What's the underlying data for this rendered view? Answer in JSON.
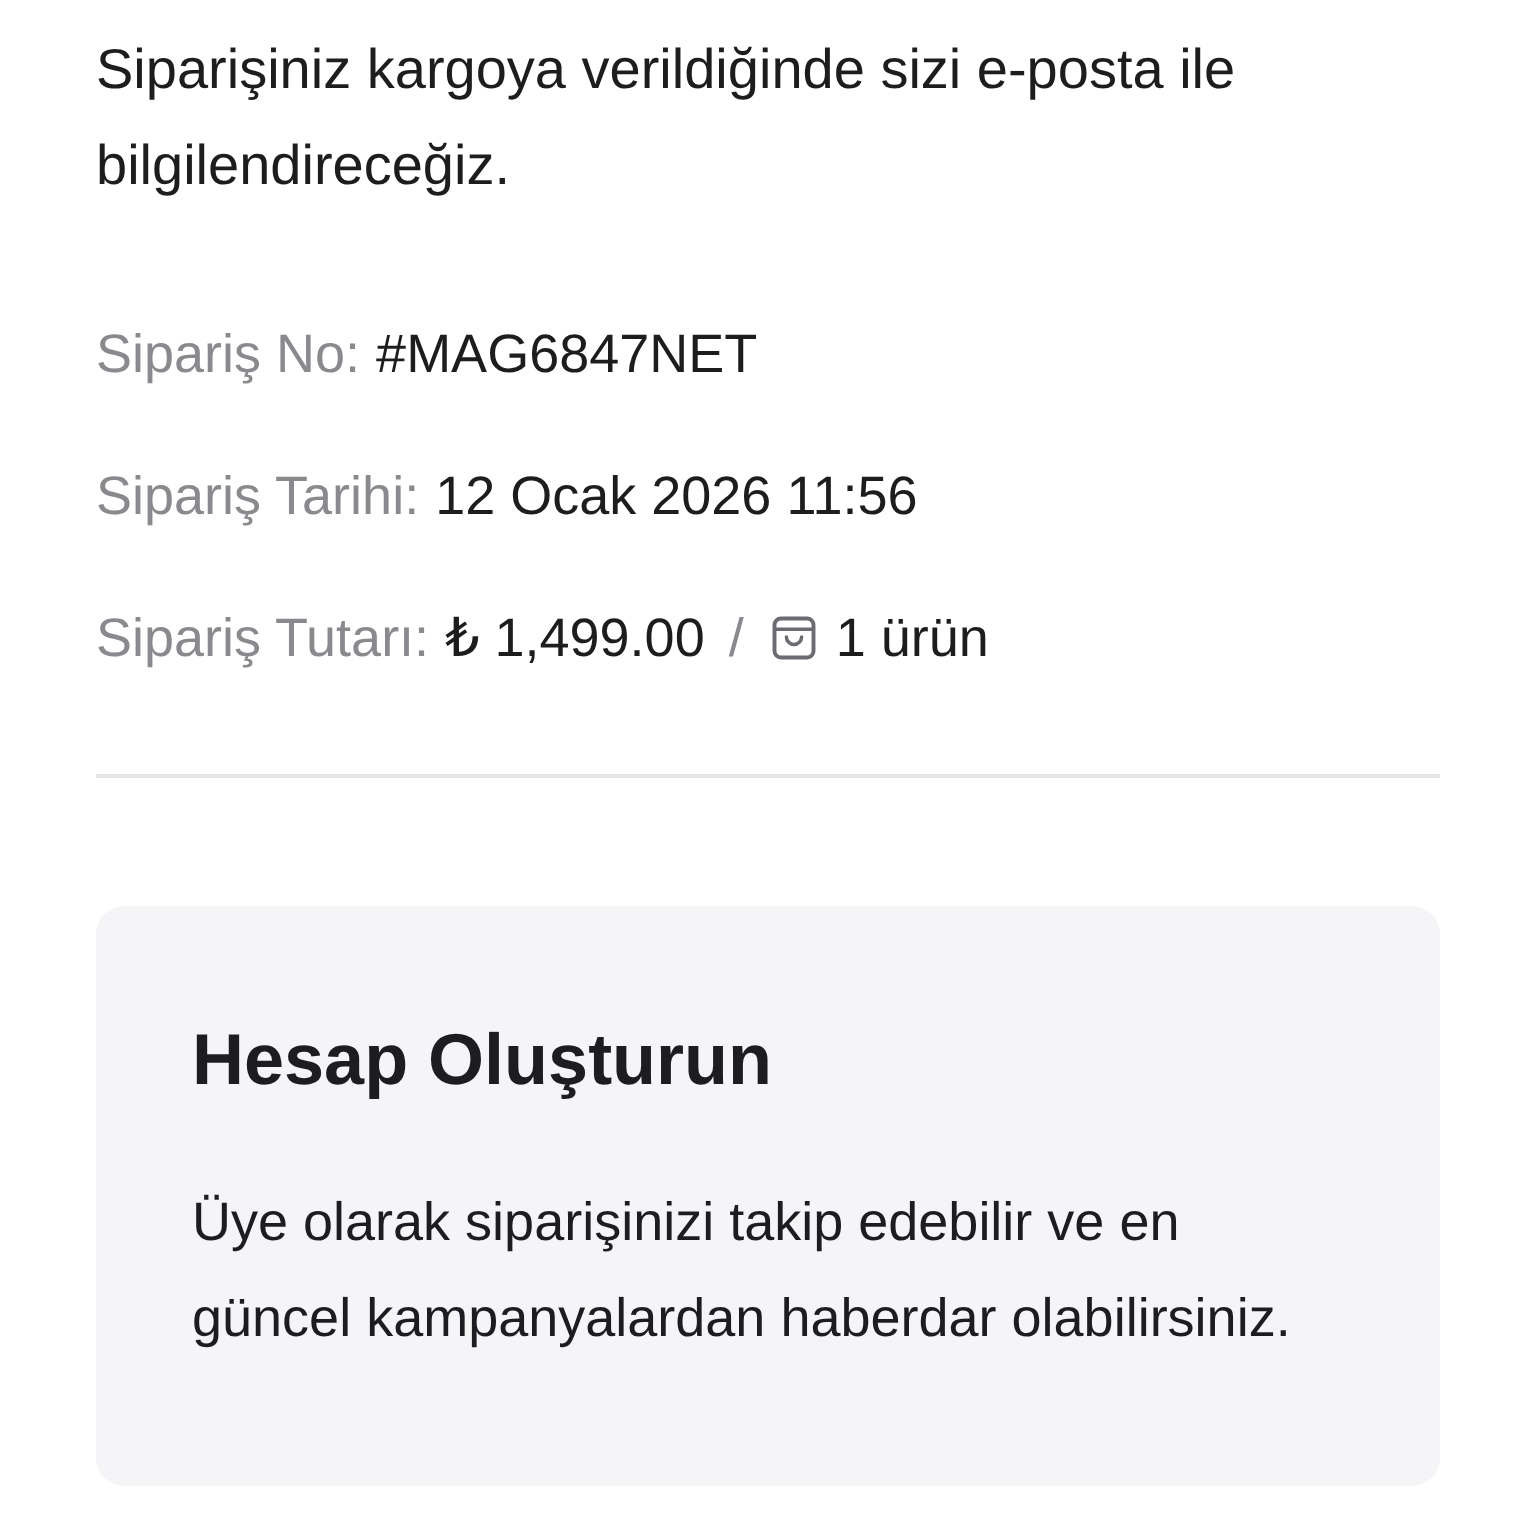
{
  "intro": "Siparişiniz kargoya verildiğinde sizi e-posta ile bilgilendireceğiz.",
  "details": [
    {
      "kind": "text",
      "label": "Sipariş No:",
      "value": "#MAG6847NET"
    },
    {
      "kind": "text",
      "label": "Sipariş Tarihi:",
      "value": "12 Ocak 2026 11:56"
    },
    {
      "kind": "total",
      "label": "Sipariş Tutarı:",
      "value": "₺ 1,499.00",
      "separator": "/",
      "items": "1 ürün"
    }
  ],
  "account_card": {
    "title": "Hesap Oluşturun",
    "text": "Üye olarak siparişinizi takip edebilir ve en güncel kampanyalardan haberdar olabilirsiniz."
  }
}
